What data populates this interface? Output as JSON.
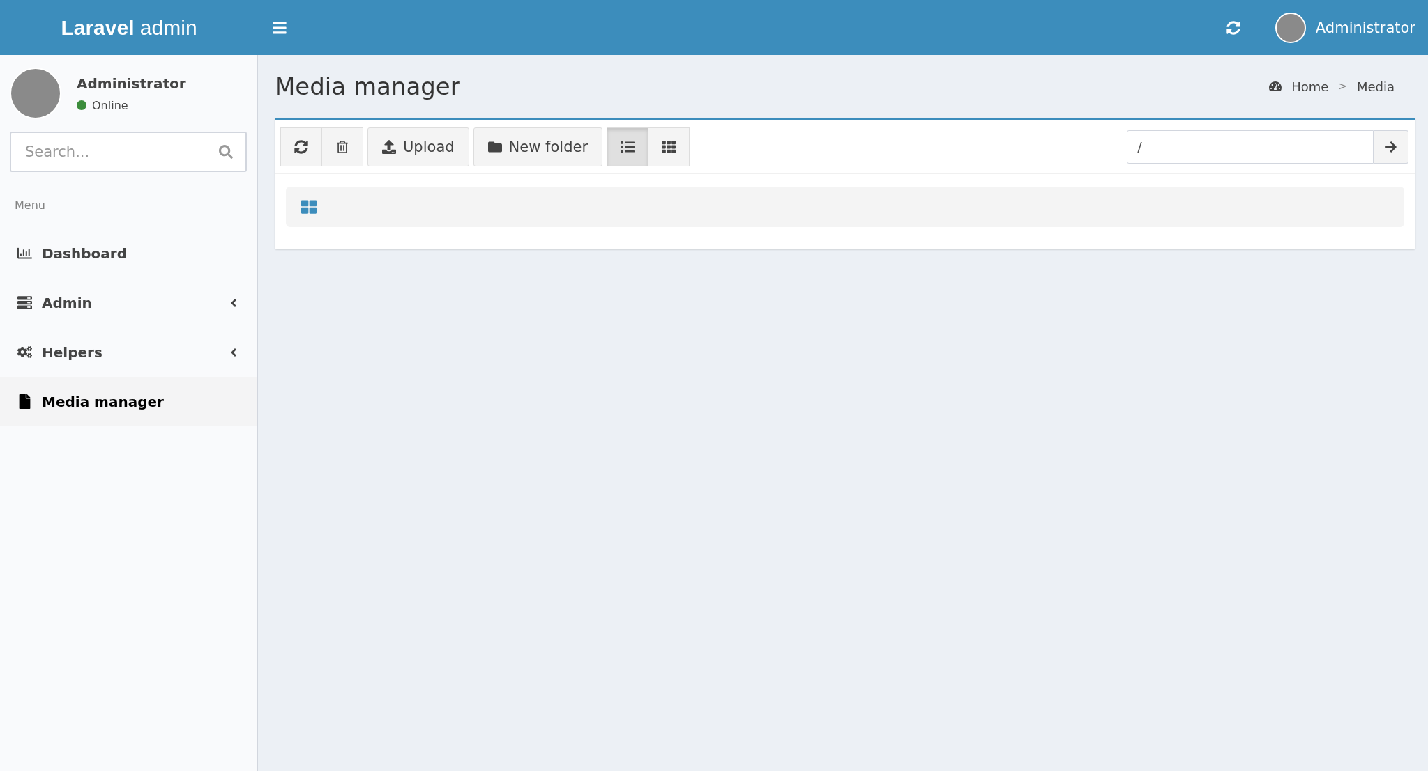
{
  "header": {
    "logo": "**Laravel** admin",
    "user_name": "Administrator"
  },
  "sidebar": {
    "user": {
      "name": "Administrator",
      "status": "Online",
      "color": "#3c8d3c"
    },
    "search": {
      "placeholder": "Search..."
    },
    "menu_header": "Menu",
    "items": [
      {
        "label": "Dashboard",
        "selected": false,
        "expandable": false
      },
      {
        "label": "Admin",
        "selected": false,
        "expandable": true
      },
      {
        "label": "Helpers",
        "selected": false,
        "expandable": true
      },
      {
        "label": "Media manager",
        "selected": true,
        "expandable": false
      }
    ]
  },
  "page": {
    "title": "Media manager",
    "breadcrumb": [
      "Home",
      ">",
      "Media"
    ]
  },
  "toolbar": {
    "upload": "Upload",
    "new_folder": "New folder",
    "views": [
      {
        "kind": "list",
        "selected": true
      },
      {
        "kind": "grid",
        "selected": false
      }
    ],
    "path": {
      "value": "/"
    }
  }
}
